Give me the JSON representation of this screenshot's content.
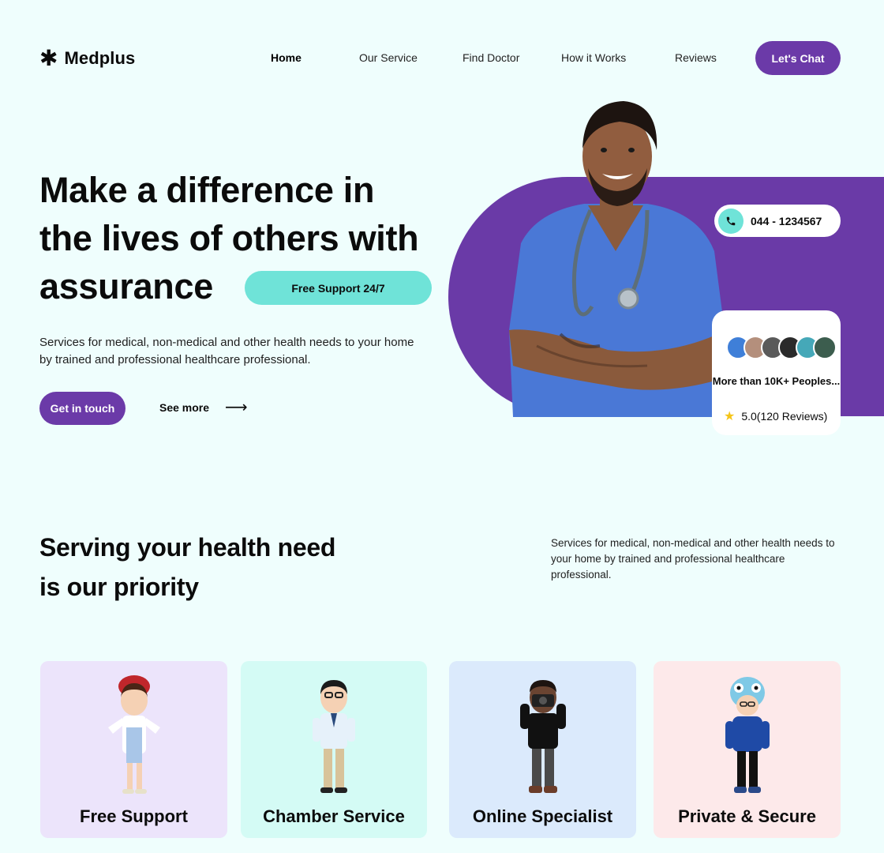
{
  "brand": {
    "name": "Medplus",
    "logo_icon": "asterisk-icon"
  },
  "nav": {
    "items": [
      {
        "label": "Home",
        "active": true
      },
      {
        "label": "Our Service"
      },
      {
        "label": "Find Doctor"
      },
      {
        "label": "How it Works"
      },
      {
        "label": "Reviews"
      }
    ],
    "cta": "Let's Chat"
  },
  "hero": {
    "title_line1": "Make a difference in",
    "title_line2": "the lives of others with",
    "title_line3": "assurance",
    "badge": "Free Support 24/7",
    "description": "Services for medical, non-medical and other health needs to your home by trained and professional healthcare professional.",
    "primary_button": "Get in touch",
    "secondary_link": "See more",
    "phone": "044 - 1234567",
    "review_title": "More than 10K+ Peoples...",
    "rating": "5.0(120 Reviews)"
  },
  "section": {
    "title_line1": "Serving your health need",
    "title_line2": "is our priority",
    "description": "Services for medical, non-medical and other health needs to your home by trained and professional healthcare professional."
  },
  "cards": [
    {
      "title": "Free Support",
      "bg": "#ece4fb"
    },
    {
      "title": "Chamber Service",
      "bg": "#d4fbf5"
    },
    {
      "title": "Online Specialist",
      "bg": "#dbeafc"
    },
    {
      "title": "Private & Secure",
      "bg": "#fde9ea"
    }
  ],
  "colors": {
    "accent": "#6b3aa8",
    "teal": "#6fe3d8",
    "background": "#effefd"
  }
}
